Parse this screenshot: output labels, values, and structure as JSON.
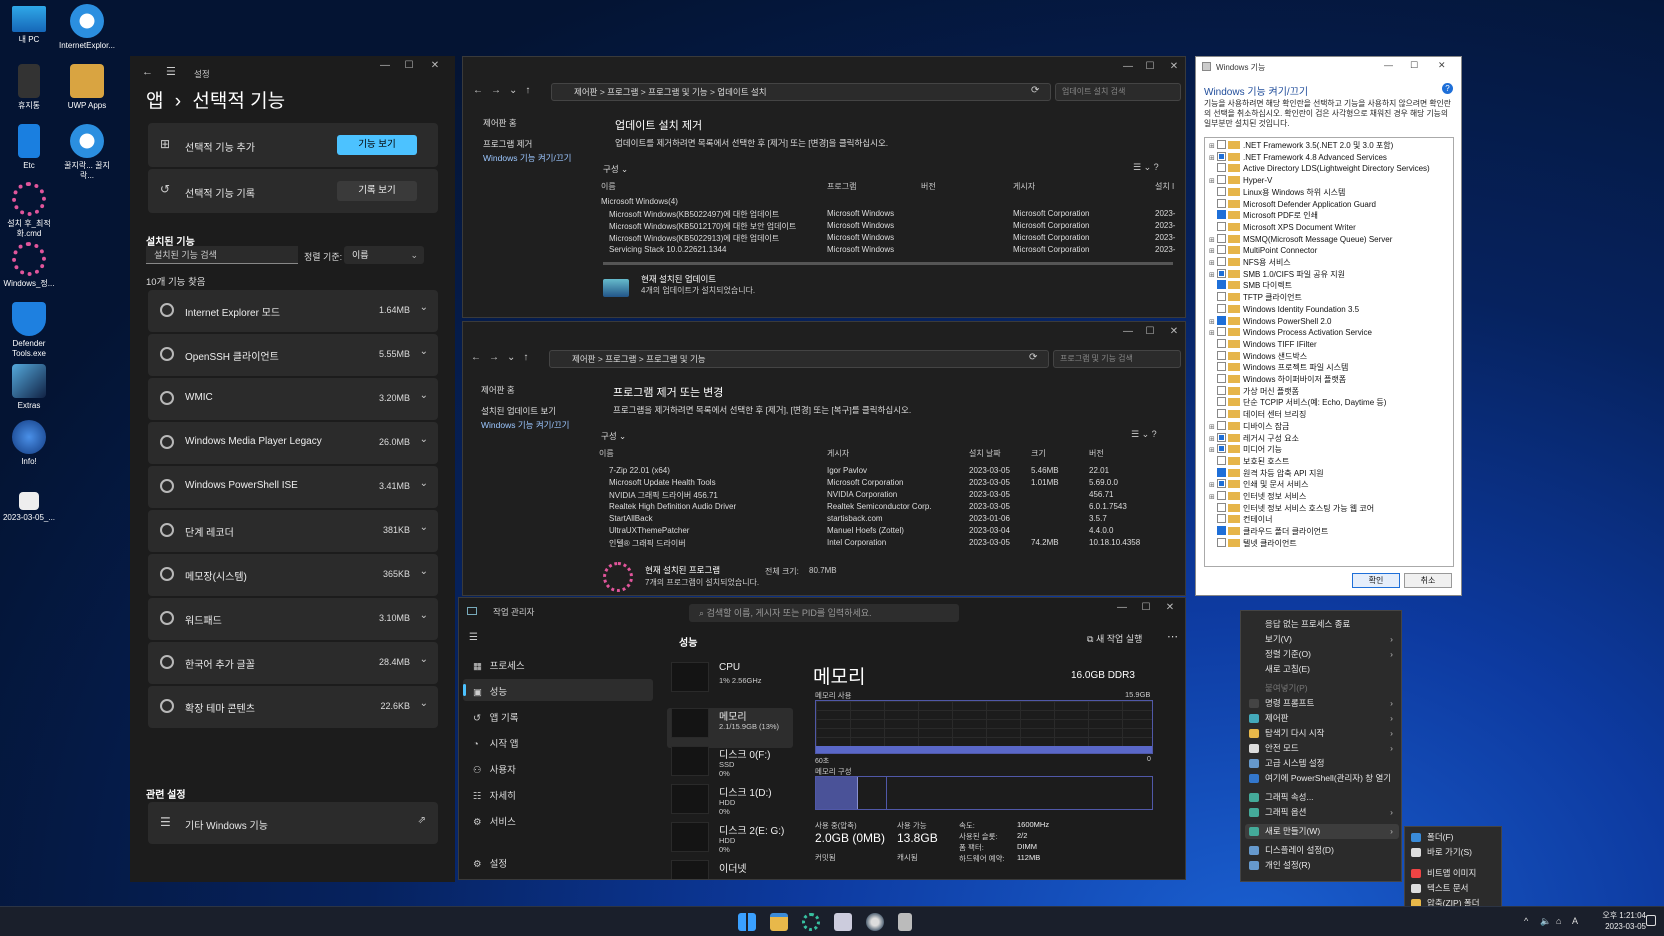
{
  "desktop": {
    "icons": [
      {
        "label": "내 PC"
      },
      {
        "label": "InternetExplor..."
      },
      {
        "label": "휴지통"
      },
      {
        "label": "UWP Apps"
      },
      {
        "label": "Etc"
      },
      {
        "label": "꿀지락... 꿀지락..."
      },
      {
        "label": "설치 후_최적화.cmd"
      },
      {
        "label": "Windows_정..."
      },
      {
        "label": "Defender Tools.exe"
      },
      {
        "label": "Extras"
      },
      {
        "label": "Info!"
      },
      {
        "label": "2023-03-05_..."
      }
    ]
  },
  "settings": {
    "app": "설정",
    "breadcrumb_app": "앱",
    "chevron": "›",
    "title": "선택적 기능",
    "add_label": "선택적 기능 추가",
    "add_btn": "기능 보기",
    "hist_label": "선택적 기능 기록",
    "hist_btn": "기록 보기",
    "installed_head": "설치된 기능",
    "search_ph": "설치된 기능 검색",
    "sort_label": "정렬 기준:",
    "sort_value": "이름",
    "count": "10개 기능 찾음",
    "features": [
      {
        "name": "Internet Explorer 모드",
        "size": "1.64MB"
      },
      {
        "name": "OpenSSH 클라이언트",
        "size": "5.55MB"
      },
      {
        "name": "WMIC",
        "size": "3.20MB"
      },
      {
        "name": "Windows Media Player Legacy",
        "size": "26.0MB"
      },
      {
        "name": "Windows PowerShell ISE",
        "size": "3.41MB"
      },
      {
        "name": "단계 레코더",
        "size": "381KB"
      },
      {
        "name": "메모장(시스템)",
        "size": "365KB"
      },
      {
        "name": "워드패드",
        "size": "3.10MB"
      },
      {
        "name": "한국어 추가 글꼴",
        "size": "28.4MB"
      },
      {
        "name": "확장 테마 콘텐츠",
        "size": "22.6KB"
      }
    ],
    "related_head": "관련 설정",
    "related_item": "기타 Windows 기능"
  },
  "upd": {
    "path": [
      "제어판",
      "프로그램",
      "프로그램 및 기능",
      "업데이트 설치"
    ],
    "search": "업데이트 설치 검색",
    "nav": [
      "제어판 홈",
      "프로그램 제거",
      "Windows 기능 켜기/끄기"
    ],
    "title": "업데이트 설치 제거",
    "desc": "업데이트를 제거하려면 목록에서 선택한 후 [제거] 또는 [변경]을 클릭하십시오.",
    "organize": "구성 ⌄",
    "cols": [
      "이름",
      "프로그램",
      "버전",
      "게시자",
      "설치 I"
    ],
    "group": "Microsoft Windows(4)",
    "rows": [
      [
        "Microsoft Windows(KB5022497)에 대한 업데이트",
        "Microsoft Windows",
        "",
        "Microsoft Corporation",
        "2023-"
      ],
      [
        "Microsoft Windows(KB5012170)에 대한 보안 업데이트",
        "Microsoft Windows",
        "",
        "Microsoft Corporation",
        "2023-"
      ],
      [
        "Microsoft Windows(KB5022913)에 대한 업데이트",
        "Microsoft Windows",
        "",
        "Microsoft Corporation",
        "2023-"
      ],
      [
        "Servicing Stack 10.0.22621.1344",
        "Microsoft Windows",
        "",
        "Microsoft Corporation",
        "2023-"
      ]
    ],
    "footer_title": "현재 설치된 업데이트",
    "footer_sub": "4개의 업데이트가 설치되었습니다."
  },
  "prog": {
    "path": [
      "제어판",
      "프로그램",
      "프로그램 및 기능"
    ],
    "search": "프로그램 및 기능 검색",
    "nav": [
      "제어판 홈",
      "설치된 업데이트 보기",
      "Windows 기능 켜기/끄기"
    ],
    "title": "프로그램 제거 또는 변경",
    "desc": "프로그램을 제거하려면 목록에서 선택한 후 [제거], [변경] 또는 [복구]를 클릭하십시오.",
    "organize": "구성 ⌄",
    "cols": [
      "이름",
      "게시자",
      "설치 날짜",
      "크기",
      "버전"
    ],
    "rows": [
      [
        "7-Zip 22.01 (x64)",
        "Igor Pavlov",
        "2023-03-05",
        "5.46MB",
        "22.01"
      ],
      [
        "Microsoft Update Health Tools",
        "Microsoft Corporation",
        "2023-03-05",
        "1.01MB",
        "5.69.0.0"
      ],
      [
        "NVIDIA 그래픽 드라이버 456.71",
        "NVIDIA Corporation",
        "2023-03-05",
        "",
        "456.71"
      ],
      [
        "Realtek High Definition Audio Driver",
        "Realtek Semiconductor Corp.",
        "2023-03-05",
        "",
        "6.0.1.7543"
      ],
      [
        "StartAllBack",
        "startisback.com",
        "2023-01-06",
        "",
        "3.5.7"
      ],
      [
        "UltraUXThemePatcher",
        "Manuel Hoefs (Zottel)",
        "2023-03-04",
        "",
        "4.4.0.0"
      ],
      [
        "인텔® 그래픽 드라이버",
        "Intel Corporation",
        "2023-03-05",
        "74.2MB",
        "10.18.10.4358"
      ]
    ],
    "footer_title": "현재 설치된 프로그램",
    "footer_total": "전체 크기:",
    "footer_size": "80.7MB",
    "footer_sub": "7개의 프로그램이 설치되었습니다."
  },
  "wf": {
    "title": "Windows 기능",
    "heading": "Windows 기능 켜기/끄기",
    "desc": "기능을 사용하려면 해당 확인란을 선택하고 기능을 사용하지 않으려면 확인란의 선택을 취소하십시오. 확인란이 검은 사각형으로 채워진 경우 해당 기능의 일부분만 설치된 것입니다.",
    "items": [
      {
        "n": ".NET Framework 3.5(.NET 2.0 및 3.0 포함)",
        "e": 1,
        "s": "off"
      },
      {
        "n": ".NET Framework 4.8 Advanced Services",
        "e": 1,
        "s": "part"
      },
      {
        "n": "Active Directory LDS(Lightweight Directory Services)",
        "e": 0,
        "s": "off"
      },
      {
        "n": "Hyper-V",
        "e": 1,
        "s": "off"
      },
      {
        "n": "Linux용 Windows 하위 시스템",
        "e": 0,
        "s": "off"
      },
      {
        "n": "Microsoft Defender Application Guard",
        "e": 0,
        "s": "off"
      },
      {
        "n": "Microsoft PDF로 인쇄",
        "e": 0,
        "s": "on"
      },
      {
        "n": "Microsoft XPS Document Writer",
        "e": 0,
        "s": "off"
      },
      {
        "n": "MSMQ(Microsoft Message Queue) Server",
        "e": 1,
        "s": "off"
      },
      {
        "n": "MultiPoint Connector",
        "e": 1,
        "s": "off"
      },
      {
        "n": "NFS용 서비스",
        "e": 1,
        "s": "off"
      },
      {
        "n": "SMB 1.0/CIFS 파일 공유 지원",
        "e": 1,
        "s": "part"
      },
      {
        "n": "SMB 다이렉트",
        "e": 0,
        "s": "on"
      },
      {
        "n": "TFTP 클라이언트",
        "e": 0,
        "s": "off"
      },
      {
        "n": "Windows Identity Foundation 3.5",
        "e": 0,
        "s": "off"
      },
      {
        "n": "Windows PowerShell 2.0",
        "e": 1,
        "s": "on"
      },
      {
        "n": "Windows Process Activation Service",
        "e": 1,
        "s": "off"
      },
      {
        "n": "Windows TIFF IFilter",
        "e": 0,
        "s": "off"
      },
      {
        "n": "Windows 샌드박스",
        "e": 0,
        "s": "off"
      },
      {
        "n": "Windows 프로젝트 파일 시스템",
        "e": 0,
        "s": "off"
      },
      {
        "n": "Windows 하이퍼바이저 플랫폼",
        "e": 0,
        "s": "off"
      },
      {
        "n": "가상 머신 플랫폼",
        "e": 0,
        "s": "off"
      },
      {
        "n": "단순 TCPIP 서비스(예: Echo, Daytime 등)",
        "e": 0,
        "s": "off"
      },
      {
        "n": "데이터 센터 브리징",
        "e": 0,
        "s": "off"
      },
      {
        "n": "디바이스 잠금",
        "e": 1,
        "s": "off"
      },
      {
        "n": "레거시 구성 요소",
        "e": 1,
        "s": "part"
      },
      {
        "n": "미디어 기능",
        "e": 1,
        "s": "part"
      },
      {
        "n": "보호된 호스트",
        "e": 0,
        "s": "off"
      },
      {
        "n": "원격 차등 압축 API 지원",
        "e": 0,
        "s": "on"
      },
      {
        "n": "인쇄 및 문서 서비스",
        "e": 1,
        "s": "part"
      },
      {
        "n": "인터넷 정보 서비스",
        "e": 1,
        "s": "off"
      },
      {
        "n": "인터넷 정보 서비스 호스팅 가능 웹 코어",
        "e": 0,
        "s": "off"
      },
      {
        "n": "컨테이너",
        "e": 0,
        "s": "off"
      },
      {
        "n": "클라우드 폴더 클라이언트",
        "e": 0,
        "s": "on"
      },
      {
        "n": "텔넷 클라이언트",
        "e": 0,
        "s": "off"
      }
    ],
    "ok": "확인",
    "cancel": "취소"
  },
  "tm": {
    "app": "작업 관리자",
    "search": "검색할 이름, 게시자 또는 PID를 입력하세요.",
    "nav": [
      "프로세스",
      "성능",
      "앱 기록",
      "시작 앱",
      "사용자",
      "자세히",
      "서비스"
    ],
    "settings": "설정",
    "section": "성능",
    "new_task": "새 작업 실행",
    "perf": [
      {
        "t": "CPU",
        "s1": "1% 2.56GHz",
        "s2": ""
      },
      {
        "t": "메모리",
        "s1": "2.1/15.9GB (13%)",
        "s2": ""
      },
      {
        "t": "디스크 0(F:)",
        "s1": "SSD",
        "s2": "0%"
      },
      {
        "t": "디스크 1(D:)",
        "s1": "HDD",
        "s2": "0%"
      },
      {
        "t": "디스크 2(E: G:)",
        "s1": "HDD",
        "s2": "0%"
      },
      {
        "t": "이더넷",
        "s1": "",
        "s2": ""
      }
    ],
    "mem_title": "메모리",
    "mem_total": "16.0GB DDR3",
    "usage_label": "메모리 사용",
    "usage_max": "15.9GB",
    "sec60": "60초",
    "zero": "0",
    "comp_label": "메모리 구성",
    "inuse_label": "사용 중(압축)",
    "inuse_val": "2.0GB (0MB)",
    "avail_label": "사용 가능",
    "avail_val": "13.8GB",
    "commit_label": "커밋됨",
    "cached_label": "캐시됨",
    "speed_label": "속도:",
    "speed_val": "1600MHz",
    "slots_label": "사용된 슬롯:",
    "slots_val": "2/2",
    "ff_label": "폼 팩터:",
    "ff_val": "DIMM",
    "hw_label": "하드웨어 예약:",
    "hw_val": "112MB",
    "mem_usage_pct": 13
  },
  "ctx": {
    "items": [
      {
        "l": "응답 없는 프로세스 종료",
        "a": 0,
        "d": 0
      },
      {
        "l": "보기(V)",
        "a": 1,
        "d": 0
      },
      {
        "l": "정렬 기준(O)",
        "a": 1,
        "d": 0
      },
      {
        "l": "새로 고침(E)",
        "a": 0,
        "d": 0
      },
      {
        "l": "붙여넣기(P)",
        "a": 0,
        "d": 1
      },
      {
        "l": "명령 프롬프트",
        "a": 1,
        "d": 0
      },
      {
        "l": "제어판",
        "a": 1,
        "d": 0
      },
      {
        "l": "탐색기 다시 시작",
        "a": 1,
        "d": 0
      },
      {
        "l": "안전 모드",
        "a": 1,
        "d": 0
      },
      {
        "l": "고급 시스템 설정",
        "a": 0,
        "d": 0
      },
      {
        "l": "여기에 PowerShell(관리자) 창 열기",
        "a": 0,
        "d": 0
      },
      {
        "l": "그래픽 속성...",
        "a": 0,
        "d": 0
      },
      {
        "l": "그래픽 옵션",
        "a": 1,
        "d": 0
      },
      {
        "l": "새로 만들기(W)",
        "a": 1,
        "d": 0
      },
      {
        "l": "디스플레이 설정(D)",
        "a": 0,
        "d": 0
      },
      {
        "l": "개인 설정(R)",
        "a": 0,
        "d": 0
      }
    ],
    "sub": [
      "폴더(F)",
      "바로 가기(S)",
      "비트맵 이미지",
      "텍스트 문서",
      "압축(ZIP) 폴더"
    ]
  },
  "taskbar": {
    "lang": "A",
    "time": "오후 1:21:04",
    "date": "2023-03-05"
  }
}
